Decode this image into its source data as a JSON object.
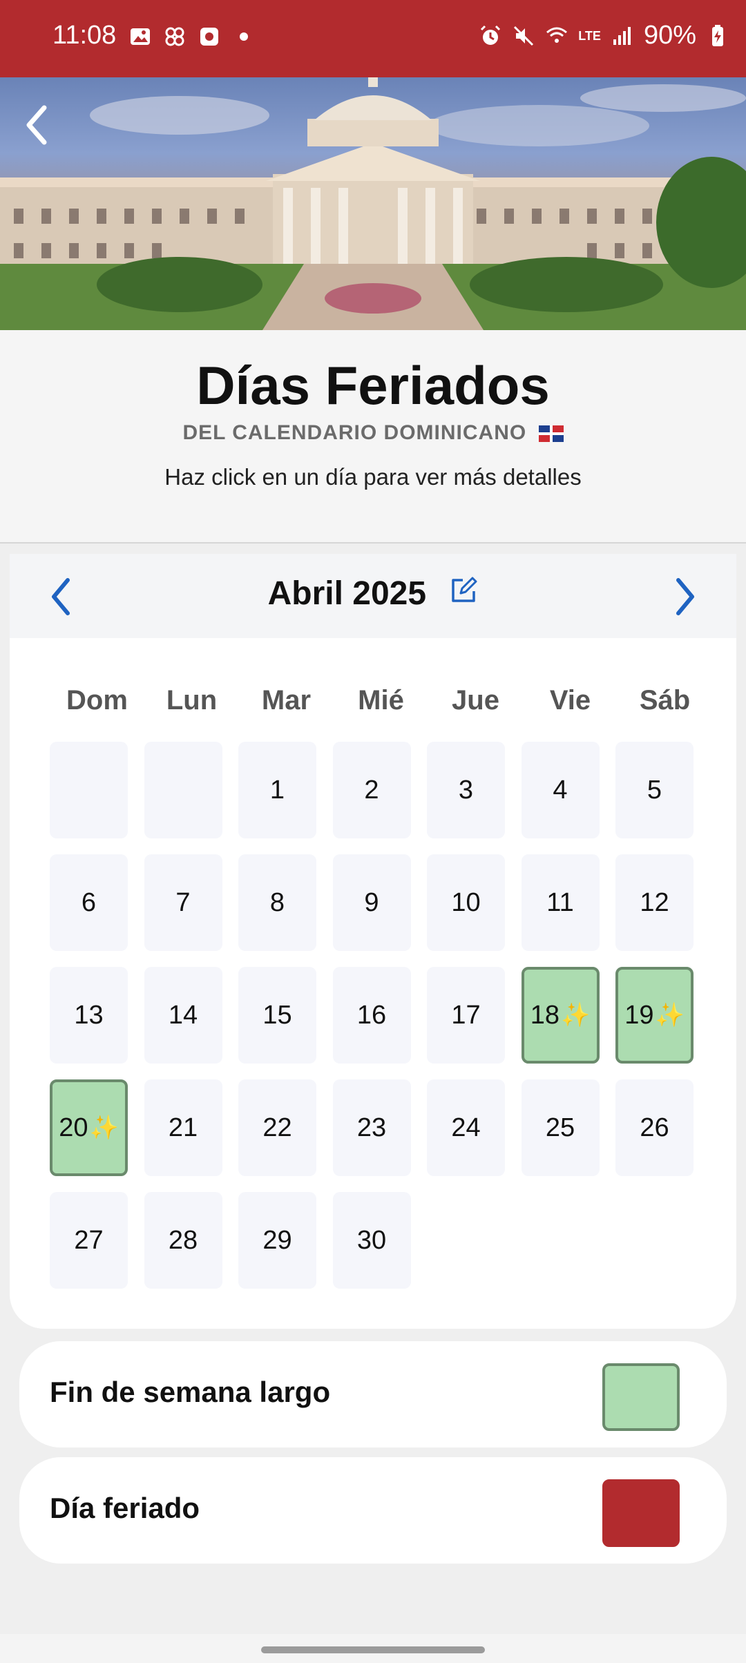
{
  "status_bar": {
    "time": "11:08",
    "battery": "90%",
    "network": "LTE"
  },
  "header": {
    "title": "Días Feriados",
    "subtitle": "DEL CALENDARIO DOMINICANO",
    "hint": "Haz click en un día para ver más detalles"
  },
  "calendar": {
    "month_label": "Abril 2025",
    "weekdays": [
      "Dom",
      "Lun",
      "Mar",
      "Mié",
      "Jue",
      "Vie",
      "Sáb"
    ],
    "days": [
      {
        "label": "",
        "holiday": false
      },
      {
        "label": "",
        "holiday": false
      },
      {
        "label": "1",
        "holiday": false
      },
      {
        "label": "2",
        "holiday": false
      },
      {
        "label": "3",
        "holiday": false
      },
      {
        "label": "4",
        "holiday": false
      },
      {
        "label": "5",
        "holiday": false
      },
      {
        "label": "6",
        "holiday": false
      },
      {
        "label": "7",
        "holiday": false
      },
      {
        "label": "8",
        "holiday": false
      },
      {
        "label": "9",
        "holiday": false
      },
      {
        "label": "10",
        "holiday": false
      },
      {
        "label": "11",
        "holiday": false
      },
      {
        "label": "12",
        "holiday": false
      },
      {
        "label": "13",
        "holiday": false
      },
      {
        "label": "14",
        "holiday": false
      },
      {
        "label": "15",
        "holiday": false
      },
      {
        "label": "16",
        "holiday": false
      },
      {
        "label": "17",
        "holiday": false
      },
      {
        "label": "18",
        "holiday": true
      },
      {
        "label": "19",
        "holiday": true
      },
      {
        "label": "20",
        "holiday": true
      },
      {
        "label": "21",
        "holiday": false
      },
      {
        "label": "22",
        "holiday": false
      },
      {
        "label": "23",
        "holiday": false
      },
      {
        "label": "24",
        "holiday": false
      },
      {
        "label": "25",
        "holiday": false
      },
      {
        "label": "26",
        "holiday": false
      },
      {
        "label": "27",
        "holiday": false
      },
      {
        "label": "28",
        "holiday": false
      },
      {
        "label": "29",
        "holiday": false
      },
      {
        "label": "30",
        "holiday": false
      }
    ]
  },
  "legend": [
    {
      "label": "Fin de semana largo",
      "color": "#acdcb0",
      "border": "#6a8a6c"
    },
    {
      "label": "Día feriado",
      "color": "#b22b2e",
      "border": "#b22b2e"
    }
  ],
  "colors": {
    "brand_red": "#b22b2e",
    "accent_blue": "#1f63c1",
    "holiday_green": "#acdcb0"
  }
}
